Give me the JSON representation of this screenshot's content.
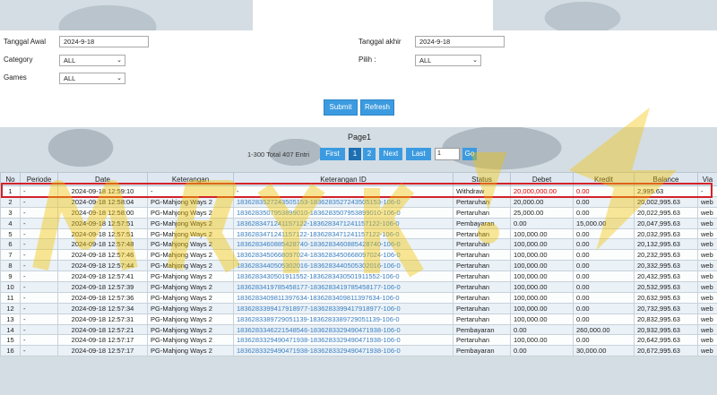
{
  "filters": {
    "start_label": "Tanggal Awal",
    "start_value": "2024-9-18",
    "end_label": "Tanggal akhir",
    "end_value": "2024-9-18",
    "category_label": "Category",
    "category_value": "ALL",
    "pilih_label": "Pilih :",
    "pilih_value": "ALL",
    "games_label": "Games",
    "games_value": "ALL",
    "submit_label": "Submit",
    "refresh_label": "Refresh"
  },
  "pager": {
    "title": "Page1",
    "total": "1-300 Total 407 Entri",
    "first": "First",
    "p1": "1",
    "p2": "2",
    "next": "Next",
    "last": "Last",
    "go_value": "1",
    "go": "Go"
  },
  "columns": [
    "No",
    "Periode",
    "Date",
    "Keterangan",
    "Keterangan ID",
    "Status",
    "Debet",
    "Kredit",
    "Balance",
    "Via"
  ],
  "rows": [
    {
      "no": "1",
      "periode": "-",
      "date": "2024-09-18 12:59:10",
      "ket": "-",
      "ketid": "-",
      "status": "Withdraw",
      "debet": "20,000,000.00",
      "kredit": "0.00",
      "balance": "2,995.63",
      "via": "-"
    },
    {
      "no": "2",
      "periode": "-",
      "date": "2024-09-18 12:58:04",
      "ket": "PG-Mahjong Ways 2",
      "ketid": "1836283527243505153-1836283527243505153-106-0",
      "status": "Pertaruhan",
      "debet": "20,000.00",
      "kredit": "0.00",
      "balance": "20,002,995.63",
      "via": "web"
    },
    {
      "no": "3",
      "periode": "-",
      "date": "2024-09-18 12:58:00",
      "ket": "PG-Mahjong Ways 2",
      "ketid": "1836283507953899010-1836283507953899010-106-0",
      "status": "Pertaruhan",
      "debet": "25,000.00",
      "kredit": "0.00",
      "balance": "20,022,995.63",
      "via": "web"
    },
    {
      "no": "4",
      "periode": "-",
      "date": "2024-09-18 12:57:51",
      "ket": "PG-Mahjong Ways 2",
      "ketid": "1836283471241157122-1836283471241157122-106-0",
      "status": "Pembayaran",
      "debet": "0.00",
      "kredit": "15,000.00",
      "balance": "20,047,995.63",
      "via": "web"
    },
    {
      "no": "5",
      "periode": "-",
      "date": "2024-09-18 12:57:51",
      "ket": "PG-Mahjong Ways 2",
      "ketid": "1836283471241157122-1836283471241157122-106-0",
      "status": "Pertaruhan",
      "debet": "100,000.00",
      "kredit": "0.00",
      "balance": "20,032,995.63",
      "via": "web"
    },
    {
      "no": "6",
      "periode": "-",
      "date": "2024-09-18 12:57:48",
      "ket": "PG-Mahjong Ways 2",
      "ketid": "1836283460885428740-1836283460885428740-106-0",
      "status": "Pertaruhan",
      "debet": "100,000.00",
      "kredit": "0.00",
      "balance": "20,132,995.63",
      "via": "web"
    },
    {
      "no": "7",
      "periode": "-",
      "date": "2024-09-18 12:57:46",
      "ket": "PG-Mahjong Ways 2",
      "ketid": "1836283450668097024-1836283450668097024-106-0",
      "status": "Pertaruhan",
      "debet": "100,000.00",
      "kredit": "0.00",
      "balance": "20,232,995.63",
      "via": "web"
    },
    {
      "no": "8",
      "periode": "-",
      "date": "2024-09-18 12:57:44",
      "ket": "PG-Mahjong Ways 2",
      "ketid": "1836283440505302016-1836283440505302016-106-0",
      "status": "Pertaruhan",
      "debet": "100,000.00",
      "kredit": "0.00",
      "balance": "20,332,995.63",
      "via": "web"
    },
    {
      "no": "9",
      "periode": "-",
      "date": "2024-09-18 12:57:41",
      "ket": "PG-Mahjong Ways 2",
      "ketid": "1836283430501911552-1836283430501911552-106-0",
      "status": "Pertaruhan",
      "debet": "100,000.00",
      "kredit": "0.00",
      "balance": "20,432,995.63",
      "via": "web"
    },
    {
      "no": "10",
      "periode": "-",
      "date": "2024-09-18 12:57:39",
      "ket": "PG-Mahjong Ways 2",
      "ketid": "1836283419785458177-1836283419785458177-106-0",
      "status": "Pertaruhan",
      "debet": "100,000.00",
      "kredit": "0.00",
      "balance": "20,532,995.63",
      "via": "web"
    },
    {
      "no": "11",
      "periode": "-",
      "date": "2024-09-18 12:57:36",
      "ket": "PG-Mahjong Ways 2",
      "ketid": "1836283409811397634-1836283409811397634-106-0",
      "status": "Pertaruhan",
      "debet": "100,000.00",
      "kredit": "0.00",
      "balance": "20,632,995.63",
      "via": "web"
    },
    {
      "no": "12",
      "periode": "-",
      "date": "2024-09-18 12:57:34",
      "ket": "PG-Mahjong Ways 2",
      "ketid": "1836283399417918977-1836283399417918977-106-0",
      "status": "Pertaruhan",
      "debet": "100,000.00",
      "kredit": "0.00",
      "balance": "20,732,995.63",
      "via": "web"
    },
    {
      "no": "13",
      "periode": "-",
      "date": "2024-09-18 12:57:31",
      "ket": "PG-Mahjong Ways 2",
      "ketid": "1836283389729051139-1836283389729051139-106-0",
      "status": "Pertaruhan",
      "debet": "100,000.00",
      "kredit": "0.00",
      "balance": "20,832,995.63",
      "via": "web"
    },
    {
      "no": "14",
      "periode": "-",
      "date": "2024-09-18 12:57:21",
      "ket": "PG-Mahjong Ways 2",
      "ketid": "1836283346221548546-1836283329490471938-106-0",
      "status": "Pembayaran",
      "debet": "0.00",
      "kredit": "260,000.00",
      "balance": "20,932,995.63",
      "via": "web"
    },
    {
      "no": "15",
      "periode": "-",
      "date": "2024-09-18 12:57:17",
      "ket": "PG-Mahjong Ways 2",
      "ketid": "1836283329490471938-1836283329490471938-106-0",
      "status": "Pertaruhan",
      "debet": "100,000.00",
      "kredit": "0.00",
      "balance": "20,642,995.63",
      "via": "web"
    },
    {
      "no": "16",
      "periode": "-",
      "date": "2024-09-18 12:57:17",
      "ket": "PG-Mahjong Ways 2",
      "ketid": "1836283329490471938-1836283329490471938-106-0",
      "status": "Pembayaran",
      "debet": "0.00",
      "kredit": "30,000.00",
      "balance": "20,672,995.63",
      "via": "web"
    }
  ],
  "colors": {
    "accent": "#3c9be0",
    "highlight": "#d2232a",
    "link": "#3a7fc1",
    "watermark": "#f2c400"
  }
}
